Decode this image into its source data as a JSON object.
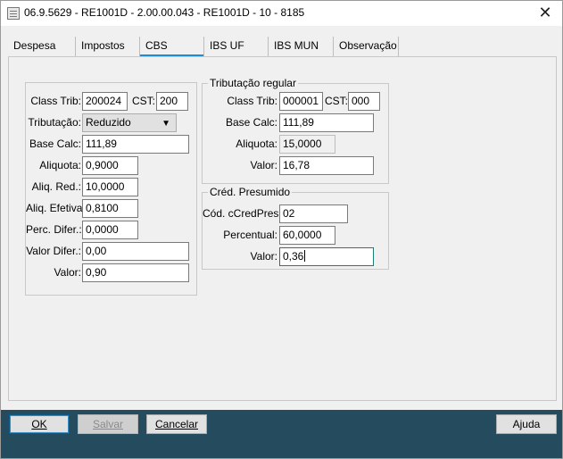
{
  "window": {
    "title": "06.9.5629 - RE1001D - 2.00.00.043 - RE1001D - 10 - 8185"
  },
  "tabs": [
    {
      "label": "Despesa"
    },
    {
      "label": "Impostos"
    },
    {
      "label": "CBS"
    },
    {
      "label": "IBS UF"
    },
    {
      "label": "IBS MUN"
    },
    {
      "label": "Observação"
    }
  ],
  "active_tab": "CBS",
  "cbs": {
    "class_trib_label": "Class Trib:",
    "class_trib": "200024",
    "cst_label": "CST:",
    "cst": "200",
    "tributacao_label": "Tributação:",
    "tributacao": "Reduzido",
    "base_calc_label": "Base Calc:",
    "base_calc": "111,89",
    "aliquota_label": "Aliquota:",
    "aliquota": "0,9000",
    "aliq_red_label": "Aliq. Red.:",
    "aliq_red": "10,0000",
    "aliq_efetiva_label": "Aliq. Efetiva:",
    "aliq_efetiva": "0,8100",
    "perc_difer_label": "Perc. Difer.:",
    "perc_difer": "0,0000",
    "valor_difer_label": "Valor Difer.:",
    "valor_difer": "0,00",
    "valor_label": "Valor:",
    "valor": "0,90"
  },
  "tributacao_regular": {
    "title": "Tributação regular",
    "class_trib_label": "Class Trib:",
    "class_trib": "000001",
    "cst_label": "CST:",
    "cst": "000",
    "base_calc_label": "Base Calc:",
    "base_calc": "111,89",
    "aliquota_label": "Aliquota:",
    "aliquota": "15,0000",
    "valor_label": "Valor:",
    "valor": "16,78"
  },
  "cred_presumido": {
    "title": "Créd. Presumido",
    "cod_label": "Cód. cCredPres:",
    "cod": "02",
    "percentual_label": "Percentual:",
    "percentual": "60,0000",
    "valor_label": "Valor:",
    "valor": "0,36"
  },
  "buttons": {
    "ok": "OK",
    "salvar": "Salvar",
    "cancelar": "Cancelar",
    "ajuda": "Ajuda"
  },
  "colors": {
    "bottom_bar": "#244b5e",
    "active_tab_underline": "#1a8fd6",
    "focused_border": "#1f7a7a"
  }
}
